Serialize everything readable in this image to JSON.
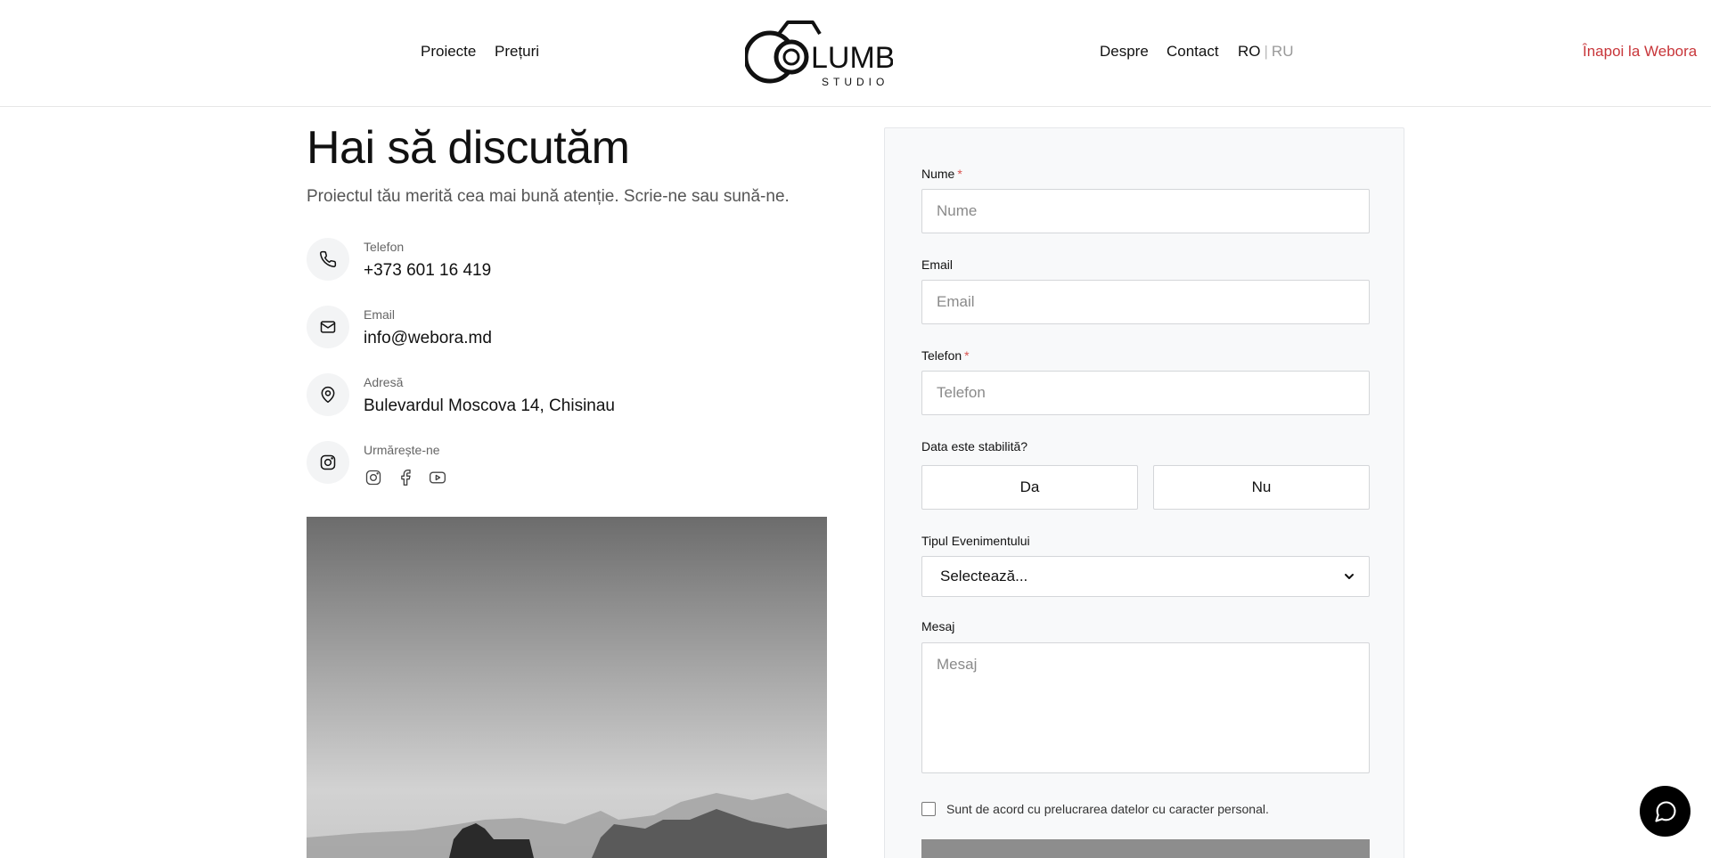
{
  "nav": {
    "left": [
      {
        "label": "Proiecte"
      },
      {
        "label": "Prețuri"
      }
    ],
    "right": [
      {
        "label": "Despre"
      },
      {
        "label": "Contact"
      }
    ],
    "lang": {
      "active": "RO",
      "separator": "|",
      "inactive": "RU"
    },
    "back_link": "Înapoi la Webora",
    "logo": {
      "word": "LUMB",
      "sub": "STUDIO"
    }
  },
  "hero": {
    "title": "Hai să discutăm",
    "subtitle": "Proiectul tău merită cea mai bună atenție. Scrie-ne sau sună-ne."
  },
  "contacts": {
    "phone": {
      "label": "Telefon",
      "value": "+373 601 16 419",
      "icon": "phone-icon"
    },
    "email": {
      "label": "Email",
      "value": "info@webora.md",
      "icon": "mail-icon"
    },
    "address": {
      "label": "Adresă",
      "value": "Bulevardul Moscova 14, Chisinau",
      "icon": "map-pin-icon"
    },
    "follow": {
      "label": "Urmărește-ne",
      "icon": "instagram-icon",
      "links": [
        "instagram-icon",
        "facebook-icon",
        "youtube-icon"
      ]
    }
  },
  "form": {
    "name": {
      "label": "Nume",
      "required": "*",
      "placeholder": "Nume"
    },
    "email": {
      "label": "Email",
      "placeholder": "Email"
    },
    "phone": {
      "label": "Telefon",
      "required": "*",
      "placeholder": "Telefon"
    },
    "date_set": {
      "label": "Data este stabilită?",
      "yes": "Da",
      "no": "Nu"
    },
    "event_type": {
      "label": "Tipul Evenimentului",
      "selected": "Selectează..."
    },
    "message": {
      "label": "Mesaj",
      "placeholder": "Mesaj"
    },
    "consent": "Sunt de acord cu prelucrarea datelor cu caracter personal."
  },
  "colors": {
    "accent_link": "#c8363a",
    "submit_bg": "#8d8d8d",
    "chat_bg": "#000000"
  }
}
